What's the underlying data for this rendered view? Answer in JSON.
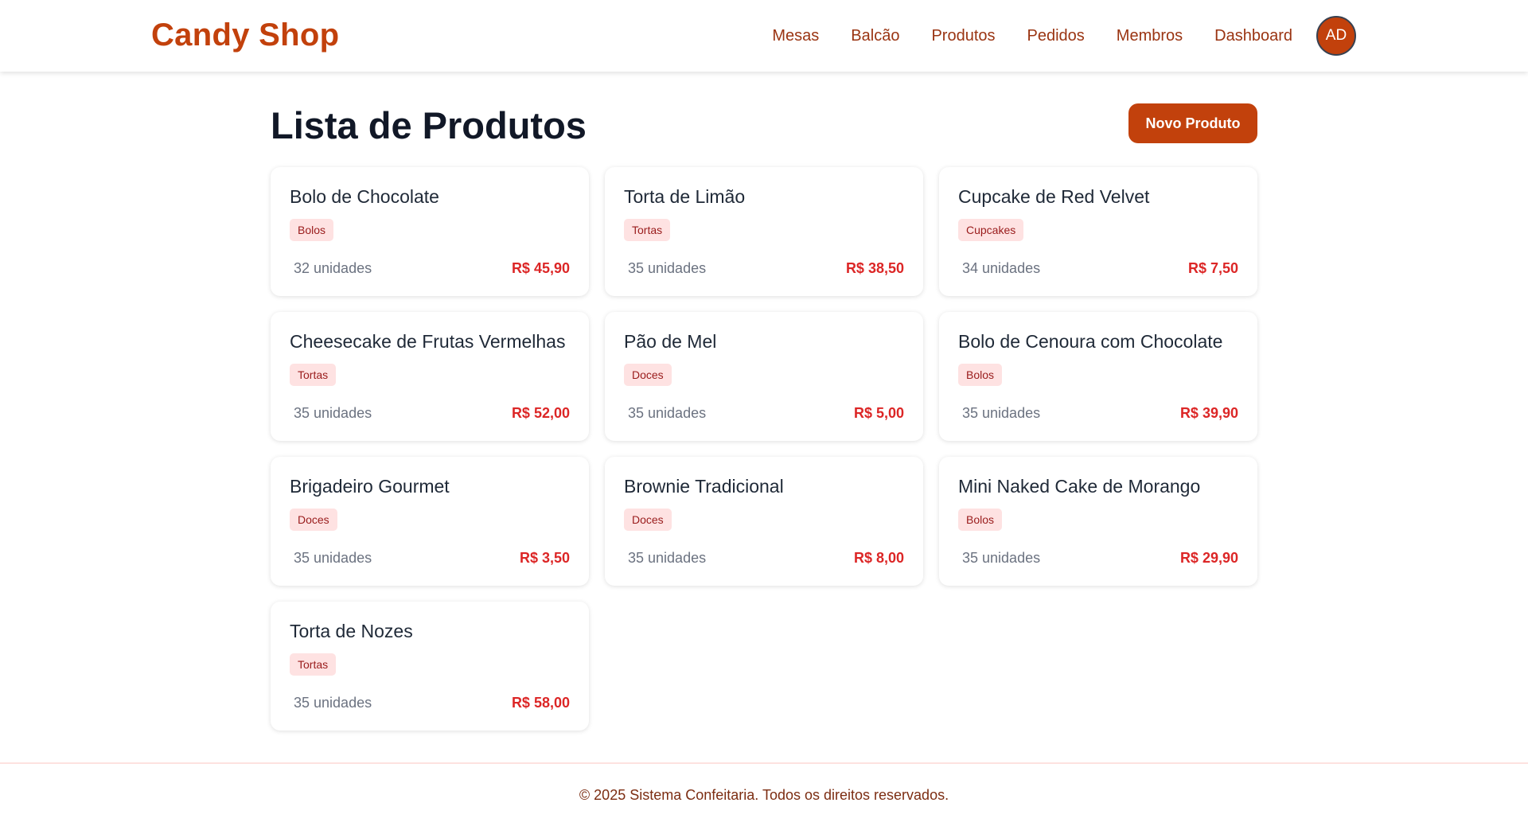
{
  "header": {
    "brand": "Candy Shop",
    "nav": [
      "Mesas",
      "Balcão",
      "Produtos",
      "Pedidos",
      "Membros",
      "Dashboard"
    ],
    "avatar_initials": "AD"
  },
  "main": {
    "title": "Lista de Produtos",
    "new_button_label": "Novo Produto",
    "products": [
      {
        "name": "Bolo de Chocolate",
        "category": "Bolos",
        "stock": "32 unidades",
        "price": "R$ 45,90"
      },
      {
        "name": "Torta de Limão",
        "category": "Tortas",
        "stock": "35 unidades",
        "price": "R$ 38,50"
      },
      {
        "name": "Cupcake de Red Velvet",
        "category": "Cupcakes",
        "stock": "34 unidades",
        "price": "R$ 7,50"
      },
      {
        "name": "Cheesecake de Frutas Vermelhas",
        "category": "Tortas",
        "stock": "35 unidades",
        "price": "R$ 52,00"
      },
      {
        "name": "Pão de Mel",
        "category": "Doces",
        "stock": "35 unidades",
        "price": "R$ 5,00"
      },
      {
        "name": "Bolo de Cenoura com Chocolate",
        "category": "Bolos",
        "stock": "35 unidades",
        "price": "R$ 39,90"
      },
      {
        "name": "Brigadeiro Gourmet",
        "category": "Doces",
        "stock": "35 unidades",
        "price": "R$ 3,50"
      },
      {
        "name": "Brownie Tradicional",
        "category": "Doces",
        "stock": "35 unidades",
        "price": "R$ 8,00"
      },
      {
        "name": "Mini Naked Cake de Morango",
        "category": "Bolos",
        "stock": "35 unidades",
        "price": "R$ 29,90"
      },
      {
        "name": "Torta de Nozes",
        "category": "Tortas",
        "stock": "35 unidades",
        "price": "R$ 58,00"
      }
    ]
  },
  "footer": {
    "text": "© 2025 Sistema Confeitaria. Todos os direitos reservados."
  },
  "colors": {
    "brand": "#c2410c",
    "nav_text": "#9a3412",
    "price": "#dc2626",
    "badge_bg": "#fee2e2",
    "badge_text": "#991b1b"
  }
}
